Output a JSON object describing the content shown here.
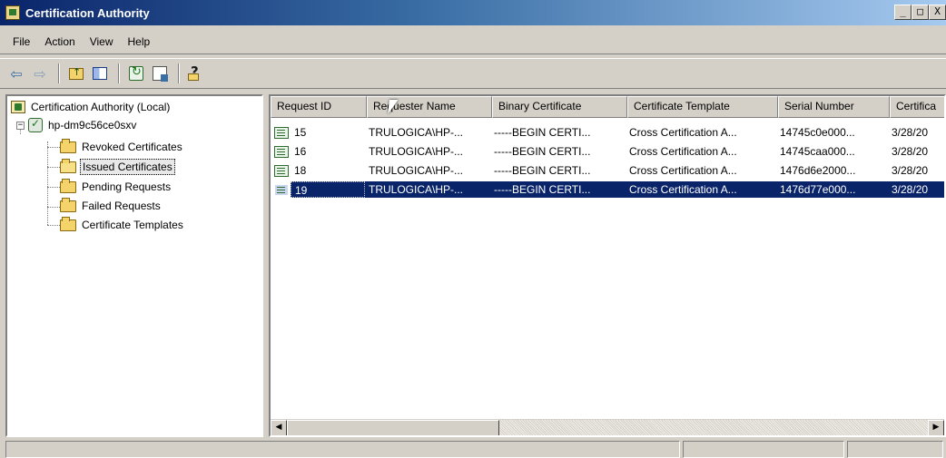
{
  "window": {
    "title": "Certification Authority",
    "controls": [
      "_",
      "□",
      "X"
    ]
  },
  "menu": [
    {
      "label": "File"
    },
    {
      "label": "Action"
    },
    {
      "label": "View"
    },
    {
      "label": "Help"
    }
  ],
  "toolbar": {
    "icons": [
      "back-arrow-icon",
      "forward-arrow-icon",
      "up-folder-icon",
      "show-hide-tree-icon",
      "refresh-icon",
      "export-list-icon",
      "help-icon"
    ]
  },
  "tree": {
    "root": "Certification Authority (Local)",
    "server": "hp-dm9c56ce0sxv",
    "folders": [
      {
        "label": "Revoked Certificates",
        "selected": false
      },
      {
        "label": "Issued Certificates",
        "selected": true
      },
      {
        "label": "Pending Requests",
        "selected": false
      },
      {
        "label": "Failed Requests",
        "selected": false
      },
      {
        "label": "Certificate Templates",
        "selected": false
      }
    ]
  },
  "list": {
    "columns": [
      "Request ID",
      "Requester Name",
      "Binary Certificate",
      "Certificate Template",
      "Serial Number",
      "Certifica"
    ],
    "rows": [
      {
        "id": "15",
        "requester": "TRULOGICA\\HP-...",
        "binary": "-----BEGIN CERTI...",
        "template": "Cross Certification A...",
        "serial": "14745c0e000...",
        "date": "3/28/20"
      },
      {
        "id": "16",
        "requester": "TRULOGICA\\HP-...",
        "binary": "-----BEGIN CERTI...",
        "template": "Cross Certification A...",
        "serial": "14745caa000...",
        "date": "3/28/20"
      },
      {
        "id": "18",
        "requester": "TRULOGICA\\HP-...",
        "binary": "-----BEGIN CERTI...",
        "template": "Cross Certification A...",
        "serial": "1476d6e2000...",
        "date": "3/28/20"
      },
      {
        "id": "19",
        "requester": "TRULOGICA\\HP-...",
        "binary": "-----BEGIN CERTI...",
        "template": "Cross Certification A...",
        "serial": "1476d77e000...",
        "date": "3/28/20",
        "selected": true
      }
    ]
  },
  "colors": {
    "title_gradient_start": "#0a246a",
    "title_gradient_end": "#a6caf0",
    "selection": "#0a246a",
    "face": "#d4d0c8"
  }
}
